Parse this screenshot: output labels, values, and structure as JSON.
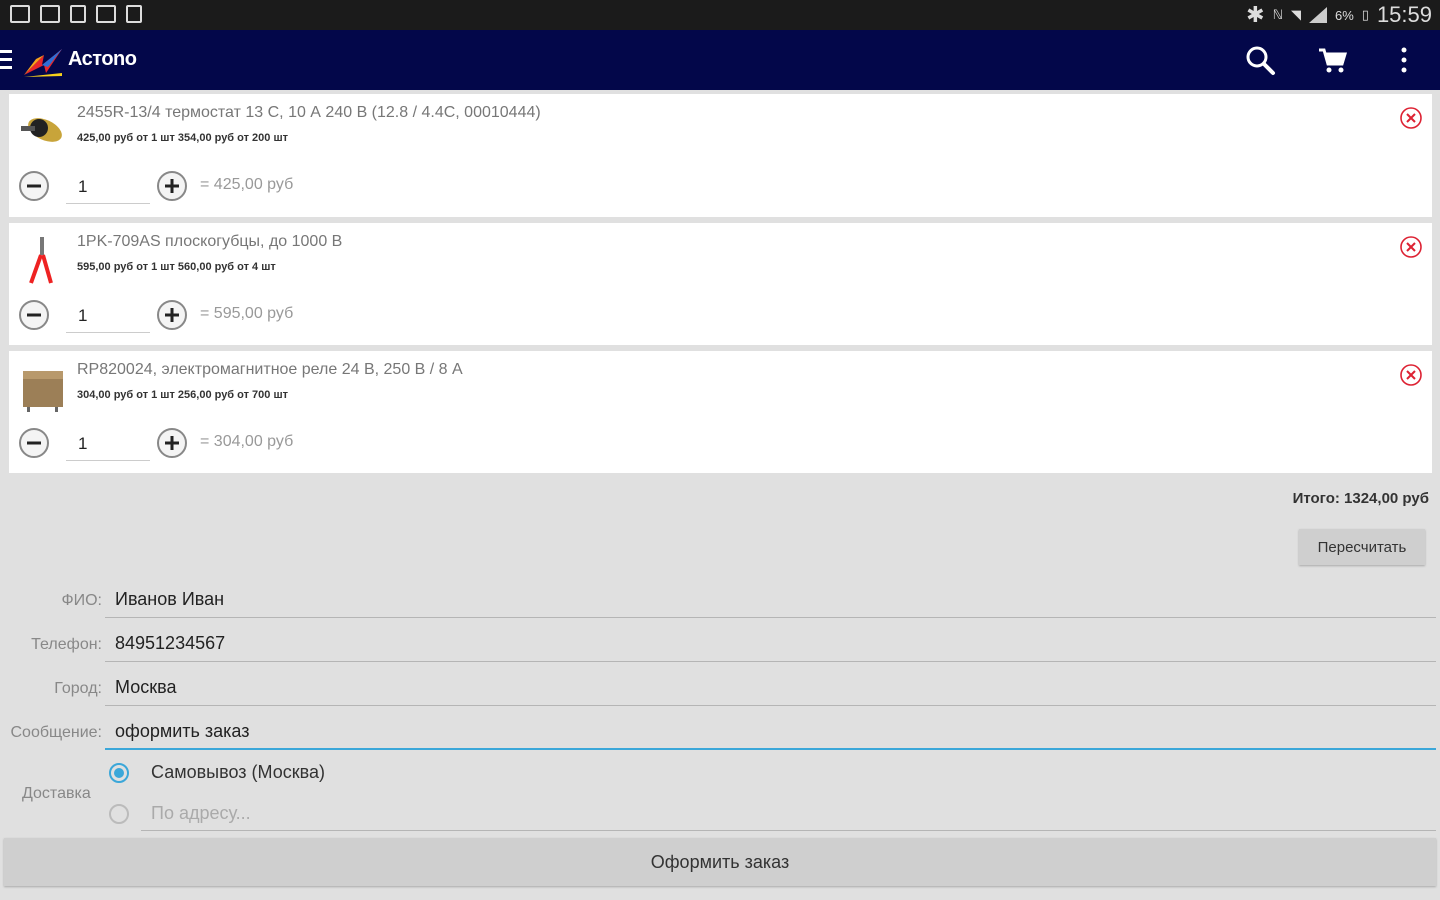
{
  "status_bar": {
    "battery": "6%",
    "time": "15:59"
  },
  "app": {
    "title": "Астоnо",
    "accent": "#03074a"
  },
  "icons": {
    "search": "search-icon",
    "cart": "cart-icon",
    "menu": "overflow-menu-icon",
    "remove": "remove-icon"
  },
  "cart": {
    "items": [
      {
        "title": "2455R-13/4 термостат 13 С, 10 А 240 В (12.8 / 4.4С, 00010444)",
        "price": "425,00 руб от 1 шт  354,00 руб от 200 шт",
        "quantity": "1",
        "line_total": "= 425,00 руб"
      },
      {
        "title": "1PK-709AS плоскогубцы, до 1000 В",
        "price": "595,00 руб от 1 шт  560,00 руб от 4 шт",
        "quantity": "1",
        "line_total": "= 595,00 руб"
      },
      {
        "title": "RP820024, электромагнитное реле 24 В, 250 В / 8 А",
        "price": "304,00 руб от 1 шт  256,00 руб от 700 шт",
        "quantity": "1",
        "line_total": "= 304,00 руб"
      }
    ],
    "total": "Итого: 1324,00 руб",
    "recalc_label": "Пересчитать"
  },
  "form": {
    "name_label": "ФИО:",
    "name_value": "Иванов Иван",
    "phone_label": "Телефон:",
    "phone_value": "84951234567",
    "city_label": "Город:",
    "city_value": "Москва",
    "message_label": "Сообщение:",
    "message_value": "оформить заказ",
    "delivery_label": "Доставка",
    "delivery_options": [
      {
        "label": "Самовывоз (Москва)",
        "selected": true
      },
      {
        "label": "По адресу...",
        "selected": false
      }
    ],
    "address_placeholder": "По адресу...",
    "submit_label": "Оформить заказ"
  }
}
